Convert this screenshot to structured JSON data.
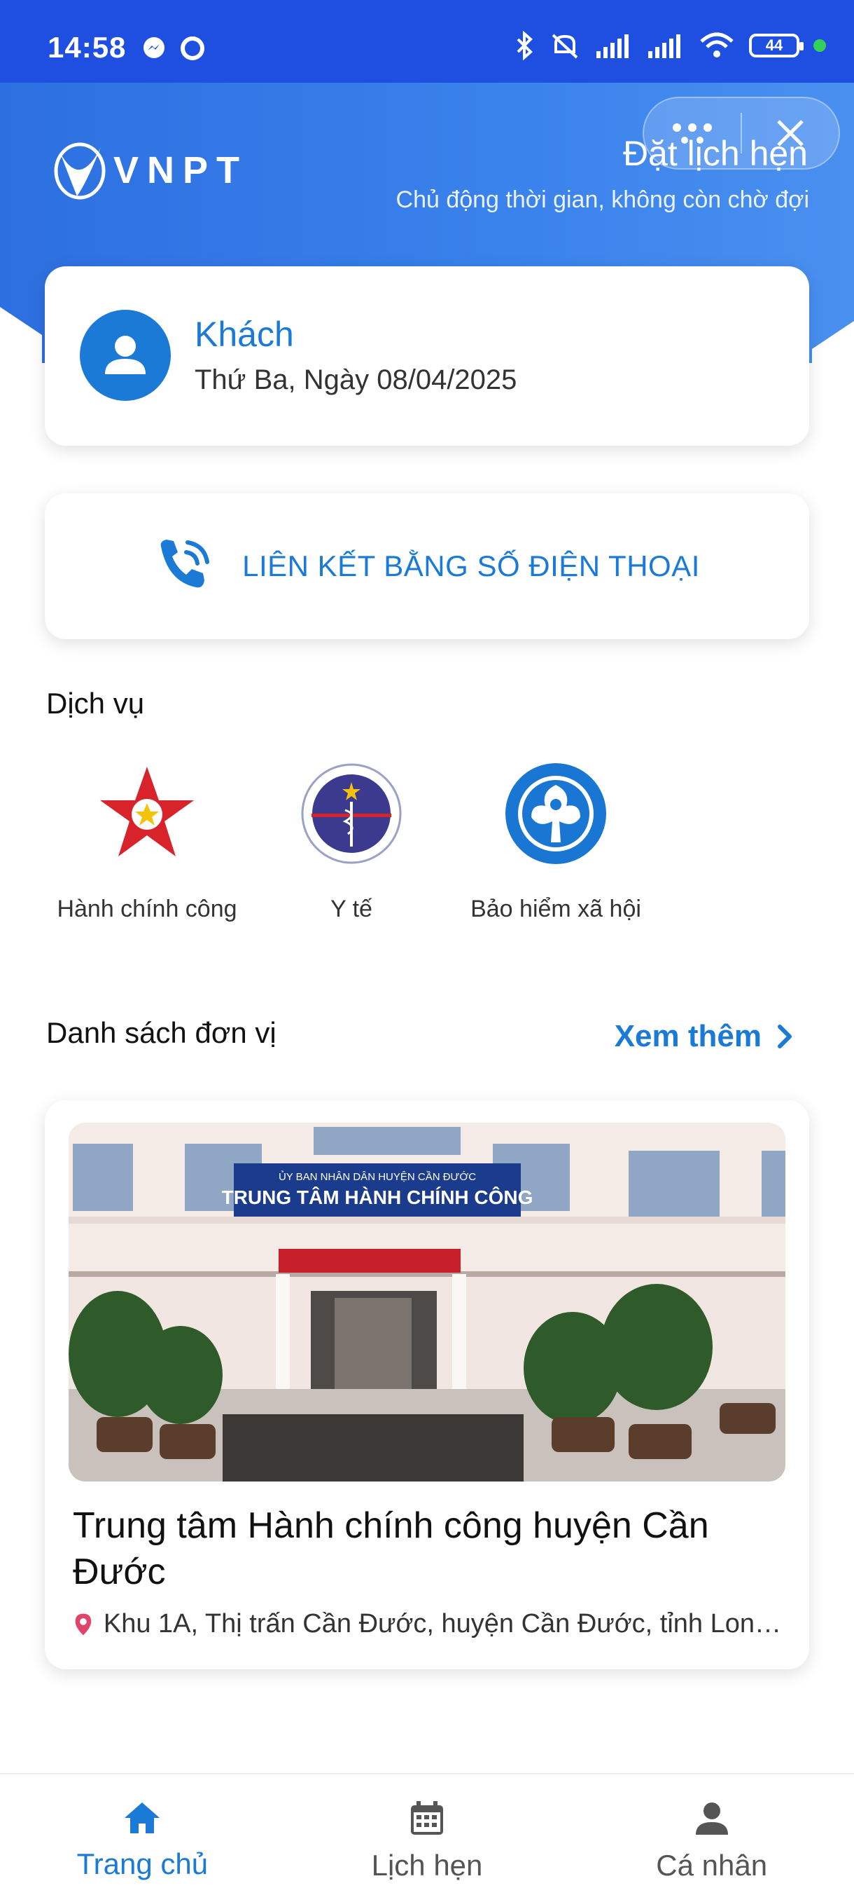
{
  "status_bar": {
    "time": "14:58",
    "battery": "44"
  },
  "header": {
    "logo_text": "VNPT",
    "title": "Đặt lịch hẹn",
    "subtitle": "Chủ động thời gian, không còn chờ đợi"
  },
  "user": {
    "name": "Khách",
    "date": "Thứ Ba, Ngày 08/04/2025"
  },
  "link_phone": {
    "label": "LIÊN KẾT BẰNG SỐ ĐIỆN THOẠI"
  },
  "services": {
    "title": "Dịch vụ",
    "items": [
      {
        "label": "Hành chính công",
        "icon": "public-administration-icon"
      },
      {
        "label": "Y tế",
        "icon": "ministry-of-health-icon"
      },
      {
        "label": "Bảo hiểm xã hội",
        "icon": "social-insurance-icon"
      }
    ]
  },
  "units": {
    "title": "Danh sách đơn vị",
    "see_more": "Xem thêm",
    "items": [
      {
        "name": "Trung tâm Hành chính công huyện Cần Đước",
        "address": "Khu 1A, Thị trấn Cần Đước, huyện Cần Đước, tỉnh Lon…",
        "sign_small": "ỦY BAN NHÂN DÂN HUYỆN CẦN ĐƯỚC",
        "sign_big": "TRUNG TÂM HÀNH CHÍNH CÔNG"
      }
    ]
  },
  "bottom_nav": {
    "items": [
      {
        "label": "Trang chủ",
        "active": true
      },
      {
        "label": "Lịch hẹn",
        "active": false
      },
      {
        "label": "Cá nhân",
        "active": false
      }
    ]
  },
  "colors": {
    "primary": "#1a7ad6",
    "status_bar": "#1f4fe0"
  }
}
